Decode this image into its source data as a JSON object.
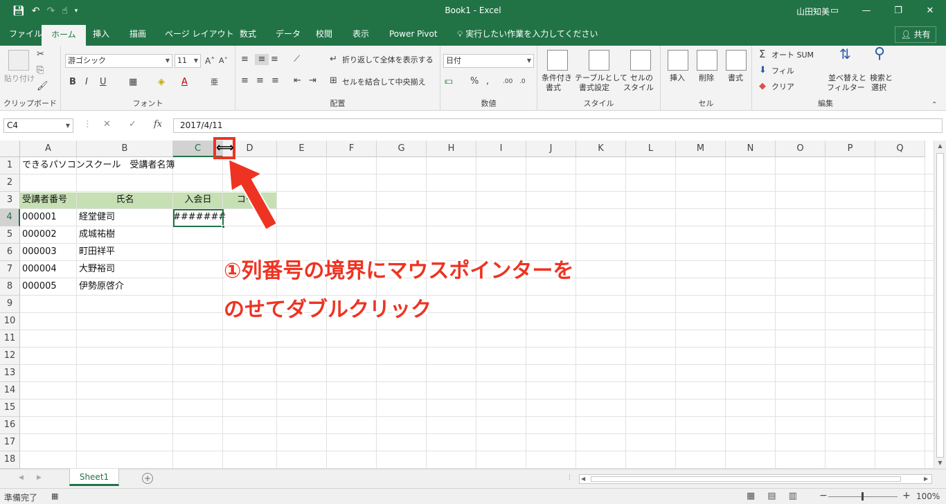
{
  "titlebar": {
    "title": "Book1 - Excel",
    "user": "山田知美",
    "qat_icons": [
      "save-icon",
      "undo-icon",
      "redo-icon",
      "touch-mode-icon",
      "customize-icon"
    ],
    "window_buttons": [
      "ribbon-display-icon",
      "minimize-icon",
      "restore-icon",
      "close-icon"
    ]
  },
  "tabs": [
    {
      "label": "ファイル"
    },
    {
      "label": "ホーム",
      "active": true
    },
    {
      "label": "挿入"
    },
    {
      "label": "描画"
    },
    {
      "label": "ページ レイアウト"
    },
    {
      "label": "数式"
    },
    {
      "label": "データ"
    },
    {
      "label": "校閲"
    },
    {
      "label": "表示"
    },
    {
      "label": "Power Pivot"
    },
    {
      "label": "実行したい作業を入力してください"
    }
  ],
  "share": "共有",
  "ribbon": {
    "clipboard": {
      "paste": "貼り付け",
      "group": "クリップボード"
    },
    "font": {
      "name": "游ゴシック",
      "size": "11",
      "bold": "B",
      "italic": "I",
      "underline": "U",
      "group": "フォント"
    },
    "alignment": {
      "wrap": "折り返して全体を表示する",
      "merge": "セルを結合して中央揃え",
      "group": "配置"
    },
    "number": {
      "format": "日付",
      "group": "数値"
    },
    "styles": {
      "cond_line1": "条件付き",
      "cond_line2": "書式",
      "table_line1": "テーブルとして",
      "table_line2": "書式設定",
      "cell_line1": "セルの",
      "cell_line2": "スタイル",
      "group": "スタイル"
    },
    "cells": {
      "insert": "挿入",
      "delete": "削除",
      "format": "書式",
      "group": "セル"
    },
    "editing": {
      "autosum": "オート SUM",
      "fill": "フィル",
      "clear": "クリア",
      "sort_line1": "並べ替えと",
      "sort_line2": "フィルター",
      "find_line1": "検索と",
      "find_line2": "選択",
      "group": "編集"
    }
  },
  "formula_bar": {
    "name_box": "C4",
    "formula": "2017/4/11",
    "fx": "fx"
  },
  "grid": {
    "columns": [
      "A",
      "B",
      "C",
      "D",
      "E",
      "F",
      "G",
      "H",
      "I",
      "J",
      "K",
      "L",
      "M",
      "N",
      "O",
      "P",
      "Q"
    ],
    "rows": [
      "1",
      "2",
      "3",
      "4",
      "5",
      "6",
      "7",
      "8",
      "9",
      "10",
      "11",
      "12",
      "13",
      "14",
      "15",
      "16",
      "17",
      "18"
    ],
    "selected_column": "C",
    "selected_row": "4",
    "header_band_color": "#c6e0b4",
    "cells": {
      "A1": "できるパソコンスクール　受講者名簿",
      "A3": "受講者番号",
      "B3": "氏名",
      "C3": "入会日",
      "D3": "コース",
      "A4": "000001",
      "B4": "経堂健司",
      "C4": "#######",
      "A5": "000002",
      "B5": "成城祐樹",
      "A6": "000003",
      "B6": "町田祥平",
      "A7": "000004",
      "B7": "大野裕司",
      "A8": "000005",
      "B8": "伊勢原啓介"
    }
  },
  "sheets": [
    {
      "label": "Sheet1",
      "active": true
    }
  ],
  "status": {
    "ready": "準備完了",
    "zoom": "100%"
  },
  "annotation": {
    "line1": "①列番号の境界にマウスポインターを",
    "line2": "のせてダブルクリック",
    "color": "#ee3322"
  },
  "colors": {
    "brand": "#217346"
  }
}
